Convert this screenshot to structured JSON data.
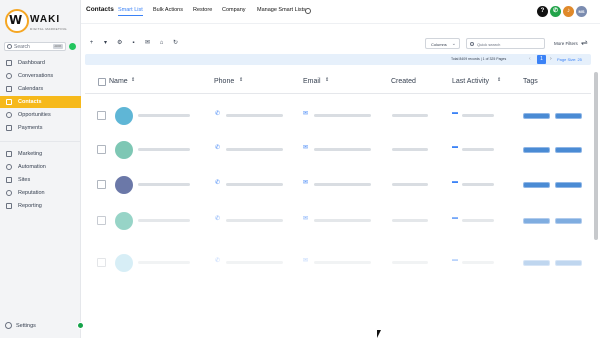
{
  "brand": {
    "logo_text": "WAKI",
    "logo_sub": "DIGITAL MARKETING",
    "logo_initial": "W"
  },
  "sidebar": {
    "search_placeholder": "Search",
    "search_shortcut": "ctrl K",
    "items": [
      {
        "label": "Dashboard",
        "icon": "dashboard-icon"
      },
      {
        "label": "Conversations",
        "icon": "chat-icon"
      },
      {
        "label": "Calendars",
        "icon": "calendar-icon"
      },
      {
        "label": "Contacts",
        "icon": "contacts-icon",
        "active": true
      },
      {
        "label": "Opportunities",
        "icon": "opportunities-icon"
      },
      {
        "label": "Payments",
        "icon": "payments-icon"
      },
      {
        "label": "Marketing",
        "icon": "marketing-icon"
      },
      {
        "label": "Automation",
        "icon": "automation-icon"
      },
      {
        "label": "Sites",
        "icon": "sites-icon"
      },
      {
        "label": "Reputation",
        "icon": "star-icon"
      },
      {
        "label": "Reporting",
        "icon": "reporting-icon"
      }
    ],
    "settings_label": "Settings"
  },
  "topnav": {
    "title": "Contacts",
    "tabs": [
      "Smart List",
      "Bulk Actions",
      "Restore",
      "Company",
      "Manage Smart Lists"
    ],
    "current_tab": "Smart List",
    "help_label": "?",
    "avatar_initials": "MS"
  },
  "toolbar": {
    "columns_label": "Columns",
    "search_placeholder": "Quick search",
    "more_filters_label": "More Filters"
  },
  "pagination": {
    "total_text": "Total 8409 records | 1 of 325 Pages",
    "current_page": "1",
    "page_size_text": "Page Size: 25"
  },
  "table": {
    "headers": [
      "Name",
      "Phone",
      "Email",
      "Created",
      "Last Activity",
      "Tags"
    ],
    "rows": 5
  },
  "colors": {
    "accent": "#f6b91b",
    "primary": "#3b82f6",
    "tag": "#4a8bd4"
  }
}
